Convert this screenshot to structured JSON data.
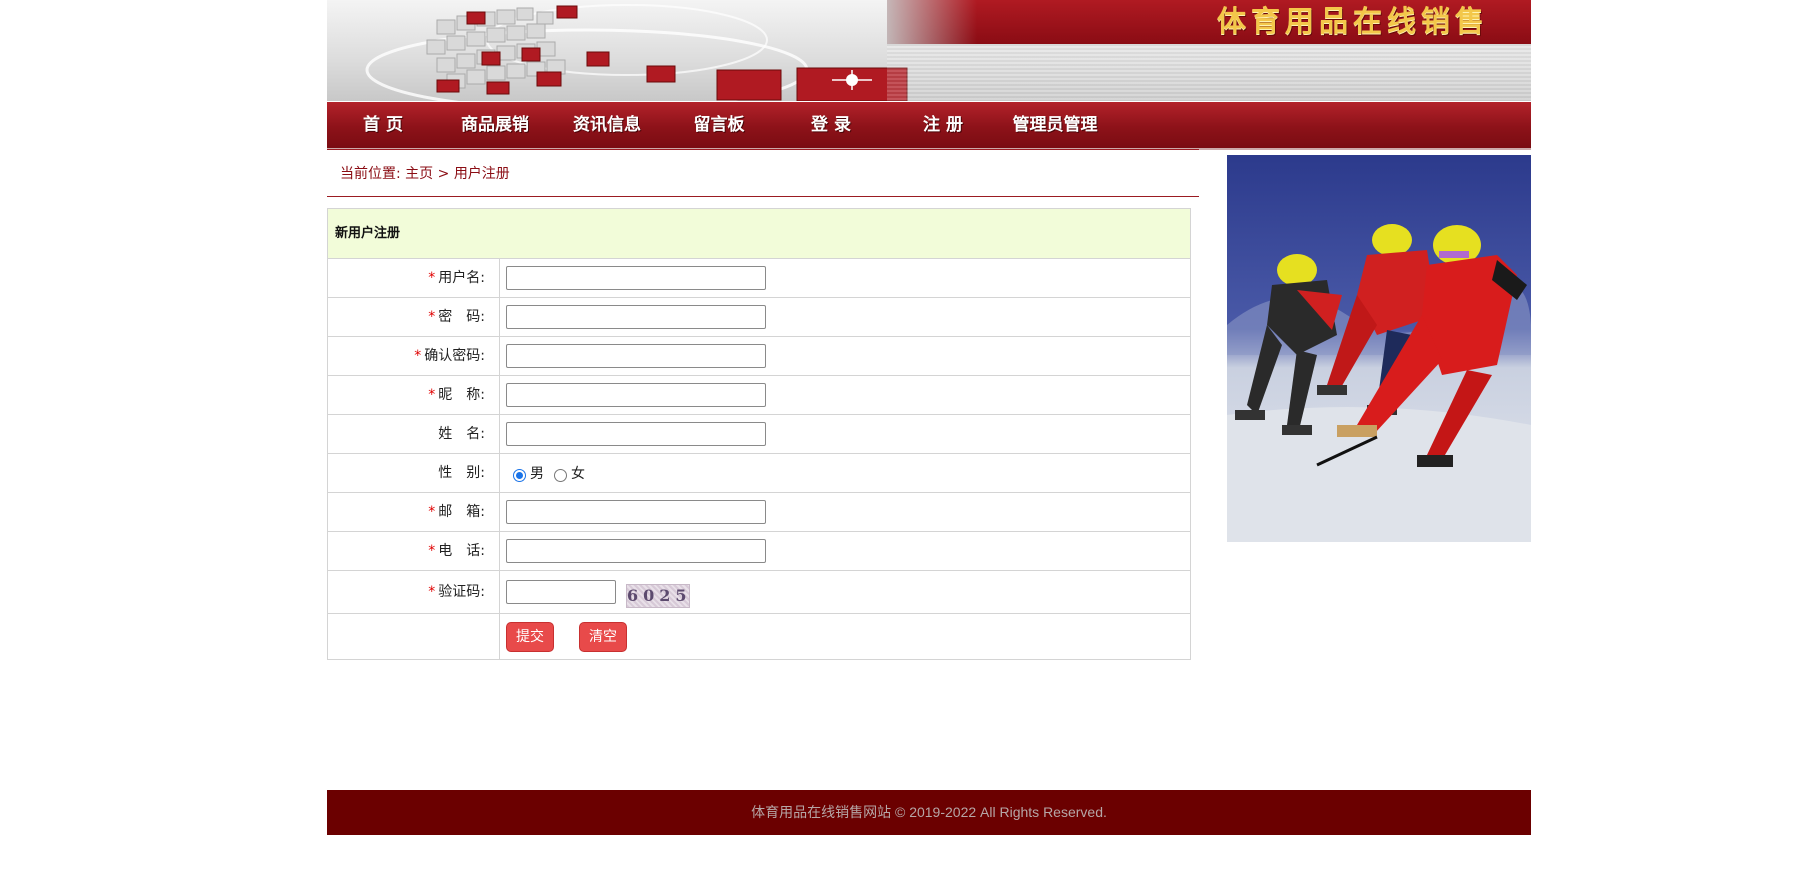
{
  "banner": {
    "site_title": "体育用品在线销售"
  },
  "nav": {
    "items": [
      "首 页",
      "商品展销",
      "资讯信息",
      "留言板",
      "登 录",
      "注 册",
      "管理员管理"
    ]
  },
  "breadcrumb": {
    "prefix": "当前位置: ",
    "home": "主页",
    "separator": " > ",
    "current": "用户注册"
  },
  "form": {
    "title": "新用户注册",
    "required_mark": "*",
    "fields": {
      "username": "用户名:",
      "password": "密　码:",
      "confirm_password": "确认密码:",
      "nickname": "昵　称:",
      "realname": "姓　名:",
      "gender": "性　别:",
      "email": "邮　箱:",
      "phone": "电　话:",
      "captcha": "验证码:"
    },
    "gender_options": [
      "男",
      "女"
    ],
    "gender_selected": "男",
    "captcha_text": "6025",
    "submit_label": "提交",
    "reset_label": "清空"
  },
  "footer": {
    "text": "体育用品在线销售网站 © 2019-2022 All Rights Reserved."
  },
  "colors": {
    "brand_red": "#8d1219",
    "footer_bg": "#6b0000",
    "form_head_bg": "#f2fcd9",
    "button_red": "#e84a4a"
  },
  "icons": {
    "banner_graphic": "red-cubes-graphic",
    "side_photo": "speed-skaters-photo"
  }
}
